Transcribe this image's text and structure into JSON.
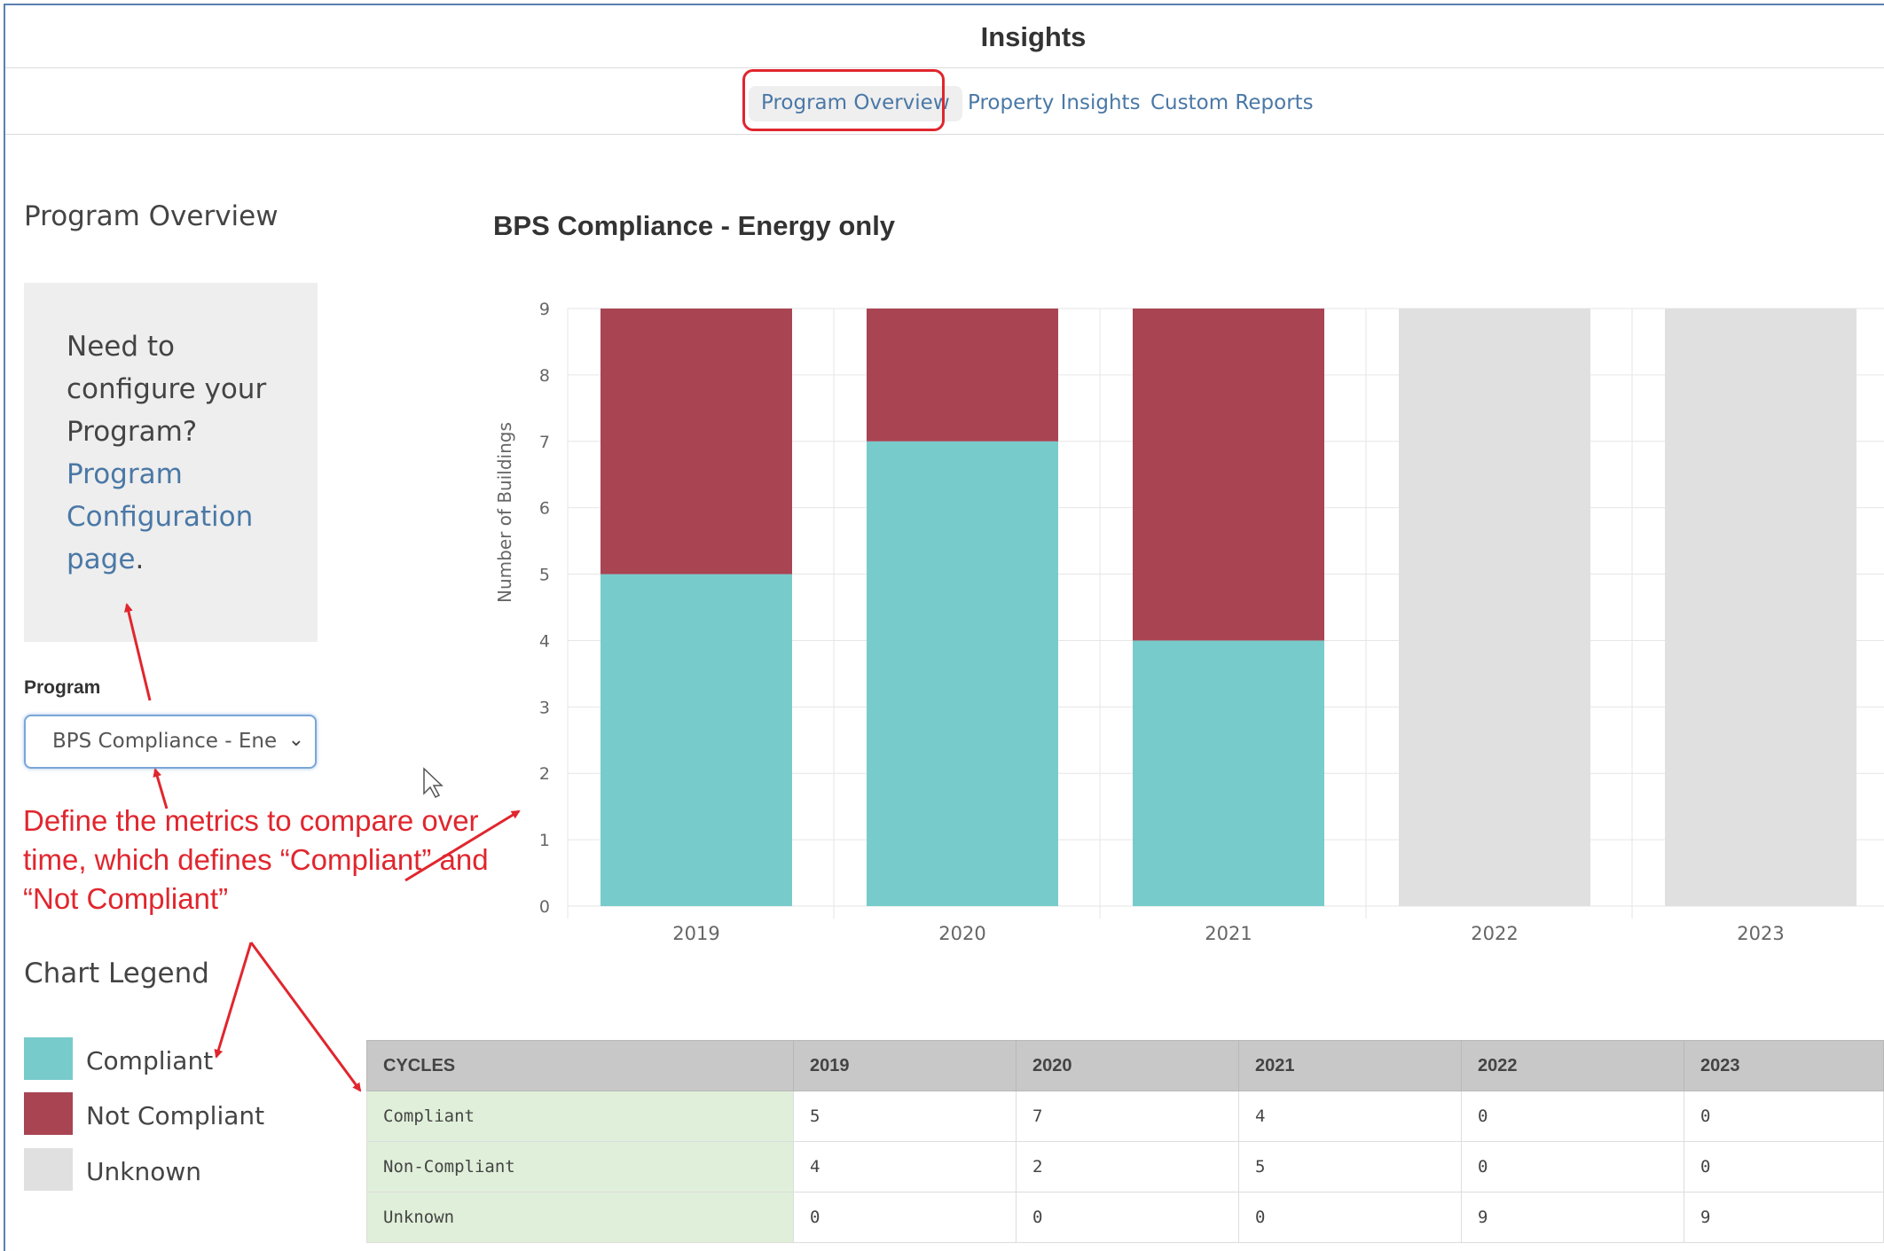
{
  "header": {
    "title": "Insights"
  },
  "tabs": [
    {
      "label": "Program Overview",
      "active": true
    },
    {
      "label": "Property Insights",
      "active": false
    },
    {
      "label": "Custom Reports",
      "active": false
    }
  ],
  "sidebar": {
    "title": "Program Overview",
    "help": {
      "text": "Need to configure your Program?",
      "link": "Program Configuration page",
      "suffix": "."
    },
    "program_label": "Program",
    "program_value": "BPS Compliance - Ene",
    "legend_title": "Chart Legend",
    "legend": [
      {
        "label": "Compliant",
        "color": "#78cbcb"
      },
      {
        "label": "Not Compliant",
        "color": "#a94453"
      },
      {
        "label": "Unknown",
        "color": "#e0e0e0"
      }
    ]
  },
  "annotation": {
    "text": "Define the metrics to compare over time, which defines “Compliant” and “Not Compliant”",
    "color": "#e0262e"
  },
  "chart_data": {
    "type": "bar",
    "stacked": true,
    "title": "BPS Compliance - Energy only",
    "ylabel": "Number of Buildings",
    "xlabel": "",
    "ylim": [
      0,
      9
    ],
    "yticks": [
      0,
      1,
      2,
      3,
      4,
      5,
      6,
      7,
      8,
      9
    ],
    "grid": true,
    "categories": [
      "2019",
      "2020",
      "2021",
      "2022",
      "2023"
    ],
    "series": [
      {
        "name": "Compliant",
        "color": "#78cbcb",
        "values": [
          5,
          7,
          4,
          0,
          0
        ]
      },
      {
        "name": "Not Compliant",
        "color": "#a94453",
        "values": [
          4,
          2,
          5,
          0,
          0
        ]
      },
      {
        "name": "Unknown",
        "color": "#e0e0e0",
        "values": [
          0,
          0,
          0,
          9,
          9
        ]
      }
    ]
  },
  "table": {
    "headers": [
      "CYCLES",
      "2019",
      "2020",
      "2021",
      "2022",
      "2023"
    ],
    "rows": [
      [
        "Compliant",
        "5",
        "7",
        "4",
        "0",
        "0"
      ],
      [
        "Non-Compliant",
        "4",
        "2",
        "5",
        "0",
        "0"
      ],
      [
        "Unknown",
        "0",
        "0",
        "0",
        "9",
        "9"
      ]
    ]
  }
}
